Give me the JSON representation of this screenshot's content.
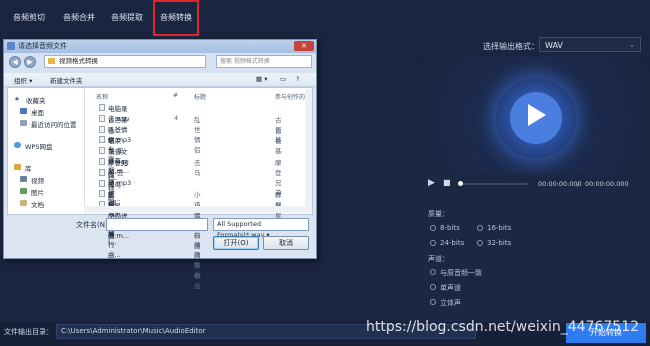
{
  "tabs": [
    "音频剪切",
    "音频合并",
    "音频提取",
    "音频转换"
  ],
  "active_tab": 3,
  "output_format": {
    "label": "选择输出格式：",
    "value": "WAV"
  },
  "player": {
    "time_current": "00:00:00.000",
    "time_sep": "/",
    "time_total": "00:00:00.000"
  },
  "settings": {
    "quality_label": "质量：",
    "quality_options": [
      "8-bits",
      "16-bits",
      "24-bits",
      "32-bits"
    ],
    "channel_label": "声道：",
    "channel_options": [
      "与原音频一致",
      "单声道",
      "立体声"
    ]
  },
  "bottom": {
    "output_dir_label": "文件输出目录：",
    "output_dir_value": "C:\\Users\\Administrator\\Music\\AudioEditor",
    "start_button": "开始转换"
  },
  "watermark": "https://blog.csdn.net/weixin_44767512",
  "dialog": {
    "title": "请选择音频文件",
    "close": "✕",
    "path": "视频格式转换",
    "search_placeholder": "搜索 视频格式转换",
    "toolbar": {
      "organize": "组织 ▾",
      "new_folder": "新建文件夹"
    },
    "nav": {
      "favorites": "收藏夹",
      "desktop": "桌面",
      "recent": "最近访问的位置",
      "wps": "WPS网盘",
      "library": "库",
      "videos": "视频",
      "pictures": "图片",
      "documents": "文档"
    },
    "columns": [
      "名称",
      "#",
      "标题",
      "参与创作的艺"
    ],
    "files": [
      {
        "name": "电脑录音.wav",
        "num": "",
        "title": "",
        "artist": ""
      },
      {
        "name": "古巨基吼爸情侣.mp3",
        "num": "4",
        "title": "乱世情侣",
        "artist": "古巨基"
      },
      {
        "name": "合唱4-张沙特-视唱...",
        "num": "",
        "title": "",
        "artist": "古巨基"
      },
      {
        "name": "李荣浩-年少有为.m...",
        "num": "",
        "title": "",
        "artist": ""
      },
      {
        "name": "录音文件.ogg",
        "num": "",
        "title": "",
        "artist": ""
      },
      {
        "name": "摩登兄弟-去马.mp3",
        "num": "",
        "title": "去马",
        "artist": "摩登兄弟"
      },
      {
        "name": "欧阳娜娜-戒不掉 (...",
        "num": "",
        "title": "",
        "artist": ""
      },
      {
        "name": "青鸟乐28《火影忍...",
        "num": "",
        "title": "",
        "artist": ""
      },
      {
        "name": "群星 - 小鸡进行曲...",
        "num": "",
        "title": "小鸡进行曲 精简歌曲",
        "artist": "群星"
      },
      {
        "name": "群星-小鸡进行曲.m...",
        "num": "",
        "title": "小鸡进行曲 精简歌曲",
        "artist": "群星"
      }
    ],
    "filename_label": "文件名(N):",
    "filetype": "All Supported Formats(*.wav ▾",
    "open_button": "打开(O)",
    "cancel_button": "取消"
  },
  "colors": {
    "accent": "#2f7bf0",
    "highlight": "#e0262b"
  }
}
